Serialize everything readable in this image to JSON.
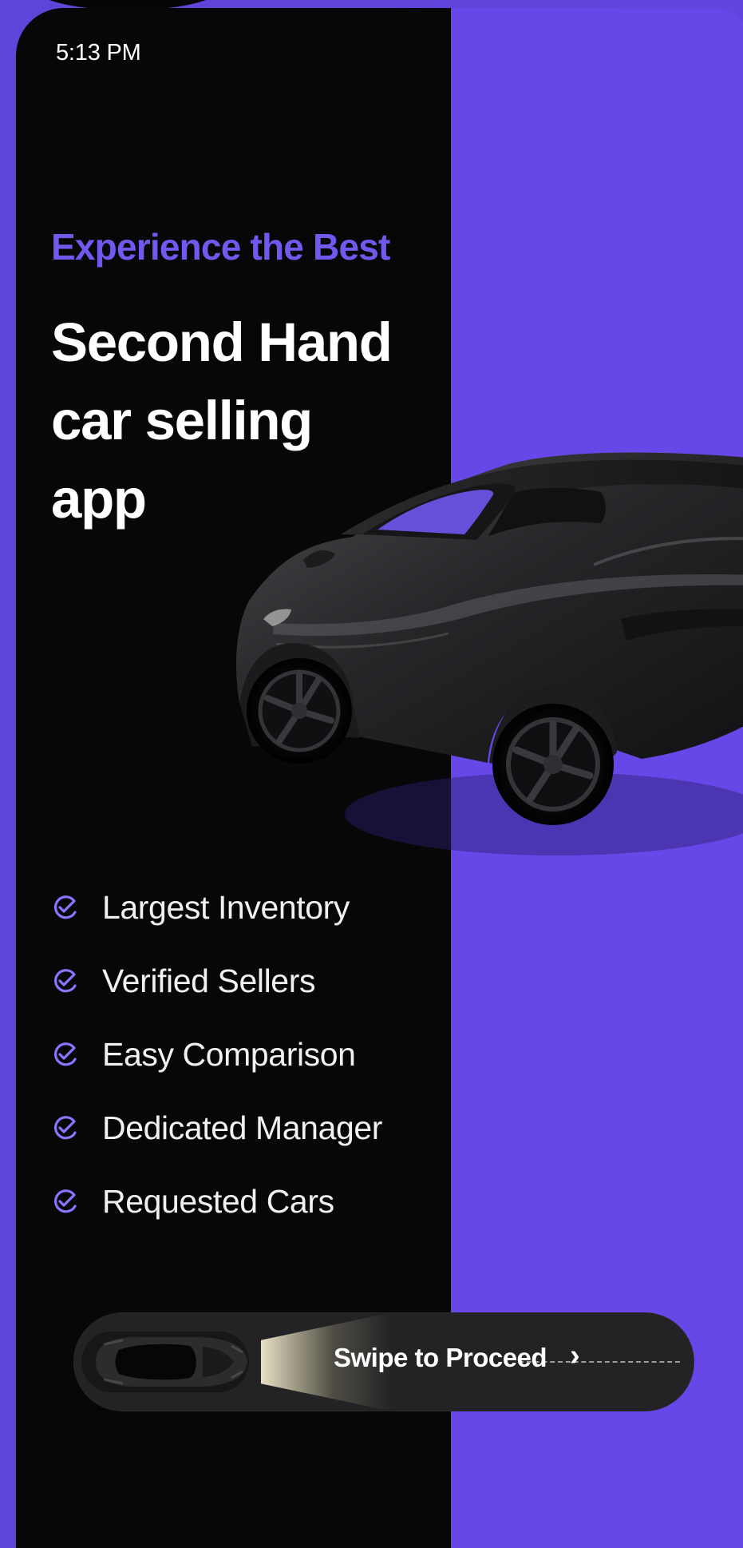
{
  "status_bar": {
    "time": "5:13 PM"
  },
  "hero": {
    "eyebrow": "Experience the Best",
    "headline": "Second Hand car selling app"
  },
  "features": [
    {
      "label": "Largest Inventory",
      "icon": "check-circle-icon"
    },
    {
      "label": "Verified Sellers",
      "icon": "check-circle-icon"
    },
    {
      "label": "Easy Comparison",
      "icon": "check-circle-icon"
    },
    {
      "label": "Dedicated Manager",
      "icon": "check-circle-icon"
    },
    {
      "label": "Requested Cars",
      "icon": "check-circle-icon"
    }
  ],
  "swipe": {
    "label": "Swipe to Proceed",
    "arrow_icon": "chevron-right-icon"
  },
  "colors": {
    "accent": "#6547e6",
    "dark_panel": "#070708",
    "eyebrow": "#7158ee",
    "text_primary": "#ffffff"
  }
}
